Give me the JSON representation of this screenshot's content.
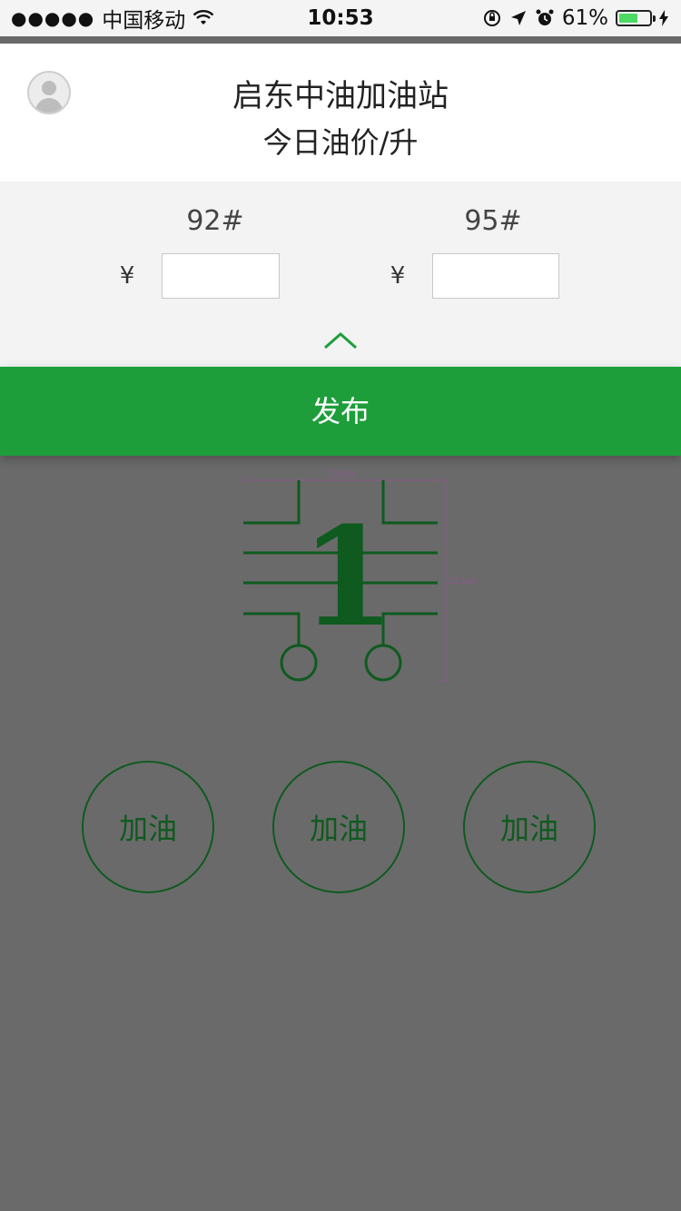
{
  "status_bar": {
    "signal_dots": "●●●●●",
    "carrier": "中国移动",
    "wifi_icon": "wifi-icon",
    "time": "10:53",
    "battery_percent": "61%",
    "battery_level": 0.61,
    "icons": [
      "rotation-lock-icon",
      "location-icon",
      "alarm-icon",
      "battery-icon",
      "charging-bolt-icon"
    ]
  },
  "header": {
    "station_name": "启东中油加油站",
    "subtitle": "今日油价/升",
    "avatar_icon": "user-avatar-icon"
  },
  "prices": [
    {
      "grade": "92#",
      "currency": "¥",
      "value": "",
      "placeholder": ""
    },
    {
      "grade": "95#",
      "currency": "¥",
      "value": "",
      "placeholder": ""
    }
  ],
  "panel": {
    "collapse_icon": "chevron-up-icon"
  },
  "publish": {
    "label": "发布"
  },
  "logo": {
    "numeral": "1",
    "width_label": "216px",
    "height_label": "222px",
    "color": "#0f5a1f"
  },
  "fuel_buttons": [
    {
      "label": "加油"
    },
    {
      "label": "加油"
    },
    {
      "label": "加油"
    }
  ],
  "colors": {
    "accent": "#1e9e3b",
    "dark_green": "#0f5a1f",
    "overlay_gray": "#6a6a6a"
  }
}
